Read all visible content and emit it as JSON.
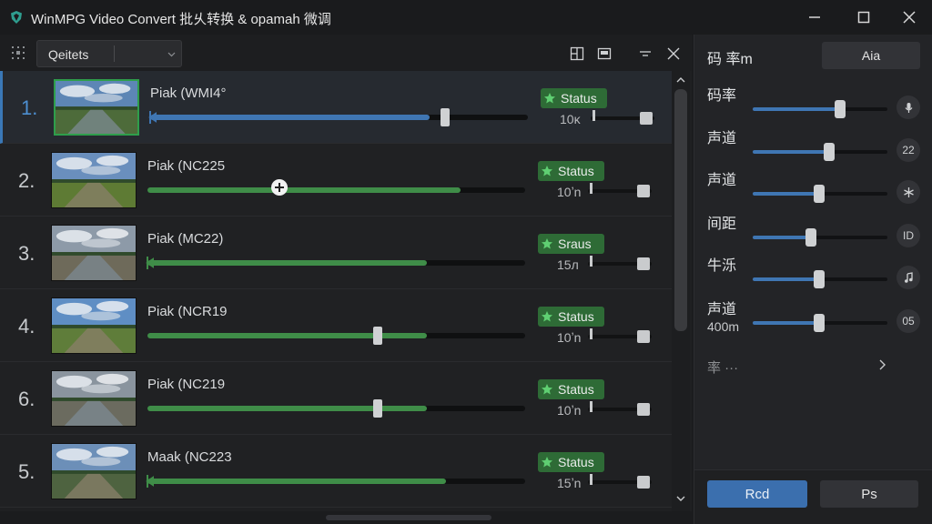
{
  "window": {
    "title": "WinMPG Video Convert 批乆转换 & opamah 微调",
    "logo_icon": "shield-logo-icon",
    "controls": [
      "minimize-icon",
      "maximize-icon",
      "close-icon"
    ]
  },
  "toolbar": {
    "queue_label": "Qeitets",
    "icons": [
      "grid-icon",
      "split-view-icon",
      "panel-view-icon",
      "collapse-icon",
      "close-icon"
    ]
  },
  "queue": {
    "items": [
      {
        "num": "1.",
        "title": "Piak (WMI4°",
        "status": "Status",
        "meta": "10ĸ",
        "progress": 0.74,
        "handle": 0.78,
        "color": "#3f76b3",
        "selected": true,
        "start_icon": "trim-start-icon"
      },
      {
        "num": "2.",
        "title": "Piak (NC225",
        "status": "Status",
        "meta": "10ʼn",
        "progress": 0.83,
        "handle": 0.35,
        "color": "#3f8d48",
        "selected": false,
        "start_icon": ""
      },
      {
        "num": "3.",
        "title": "Piak (MC22)",
        "status": "Sraus",
        "meta": "15л",
        "progress": 0.74,
        "handle": null,
        "color": "#3f8d48",
        "selected": false,
        "start_icon": "trim-start-icon"
      },
      {
        "num": "4.",
        "title": "Piak (NCR19",
        "status": "Status",
        "meta": "10ʼn",
        "progress": 0.74,
        "handle": 0.61,
        "color": "#3f8d48",
        "selected": false,
        "start_icon": ""
      },
      {
        "num": "6.",
        "title": "Piak (NC219",
        "status": "Status",
        "meta": "10ʼn",
        "progress": 0.74,
        "handle": 0.61,
        "color": "#3f8d48",
        "selected": false,
        "start_icon": ""
      },
      {
        "num": "5.",
        "title": "Maak (NC223",
        "status": "Status",
        "meta": "15ʼn",
        "progress": 0.79,
        "handle": null,
        "color": "#3f8d48",
        "selected": false,
        "start_icon": "trim-start-icon"
      }
    ]
  },
  "settings": {
    "header": "码 率m",
    "header_button": "Aia",
    "rows": [
      {
        "label": "码率",
        "sub": "",
        "value": 0.65,
        "icon": "mic-icon",
        "icon_text": ""
      },
      {
        "label": "声道",
        "sub": "",
        "value": 0.57,
        "icon": "",
        "icon_text": "22"
      },
      {
        "label": "声道",
        "sub": "",
        "value": 0.49,
        "icon": "asterisk-icon",
        "icon_text": ""
      },
      {
        "label": "间距",
        "sub": "",
        "value": 0.43,
        "icon": "",
        "icon_text": "ID"
      },
      {
        "label": "牛泺",
        "sub": "",
        "value": 0.49,
        "icon": "music-note-icon",
        "icon_text": ""
      },
      {
        "label": "声道",
        "sub": "400m",
        "value": 0.49,
        "icon": "",
        "icon_text": "05"
      }
    ],
    "more_label": "率 ···",
    "primary_button": "Rcd",
    "secondary_button": "Ps"
  },
  "colors": {
    "accent_blue": "#3f76b3",
    "status_green": "#2e6b36",
    "progress_green": "#3f8d48",
    "background": "#1f2022"
  }
}
